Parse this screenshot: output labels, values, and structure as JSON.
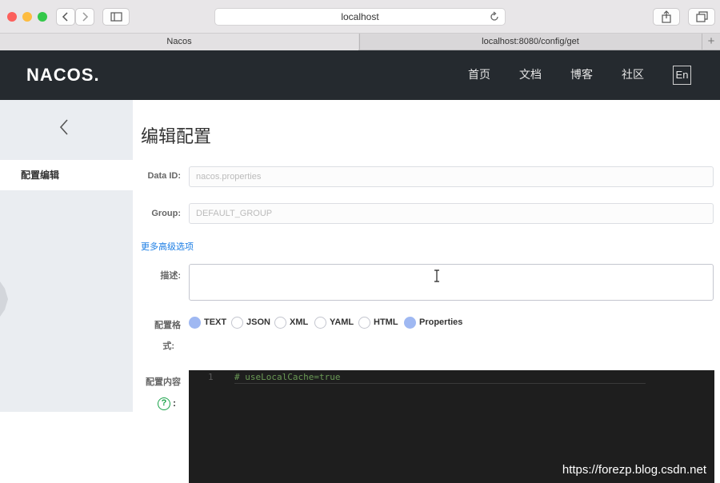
{
  "browser": {
    "address": "localhost",
    "tabs": [
      {
        "label": "Nacos"
      },
      {
        "label": "localhost:8080/config/get"
      }
    ],
    "new_tab": "+"
  },
  "header": {
    "logo": "NACOS.",
    "nav": [
      "首页",
      "文档",
      "博客",
      "社区"
    ],
    "lang": "En"
  },
  "sidebar": {
    "back": "<",
    "item": "配置编辑"
  },
  "form": {
    "title": "编辑配置",
    "data_id_label": "Data ID:",
    "data_id_value": "nacos.properties",
    "group_label": "Group:",
    "group_value": "DEFAULT_GROUP",
    "advanced_link": "更多高级选项",
    "desc_label": "描述:",
    "desc_value": "",
    "format_label_1": "配置格",
    "format_label_2": "式:",
    "formats": [
      "TEXT",
      "JSON",
      "XML",
      "YAML",
      "HTML",
      "Properties"
    ],
    "selected_formats": [
      "TEXT",
      "Properties"
    ],
    "content_label": "配置内容",
    "content_help": "?",
    "content_colon": ":"
  },
  "editor": {
    "line_no": "1",
    "line": "# useLocalCache=true"
  },
  "watermark": "https://forezp.blog.csdn.net",
  "colors": {
    "header_bg": "#252a2f",
    "accent": "#1b7de4",
    "radio_selected": "#9fb8f2",
    "code_comment": "#6a9955"
  }
}
